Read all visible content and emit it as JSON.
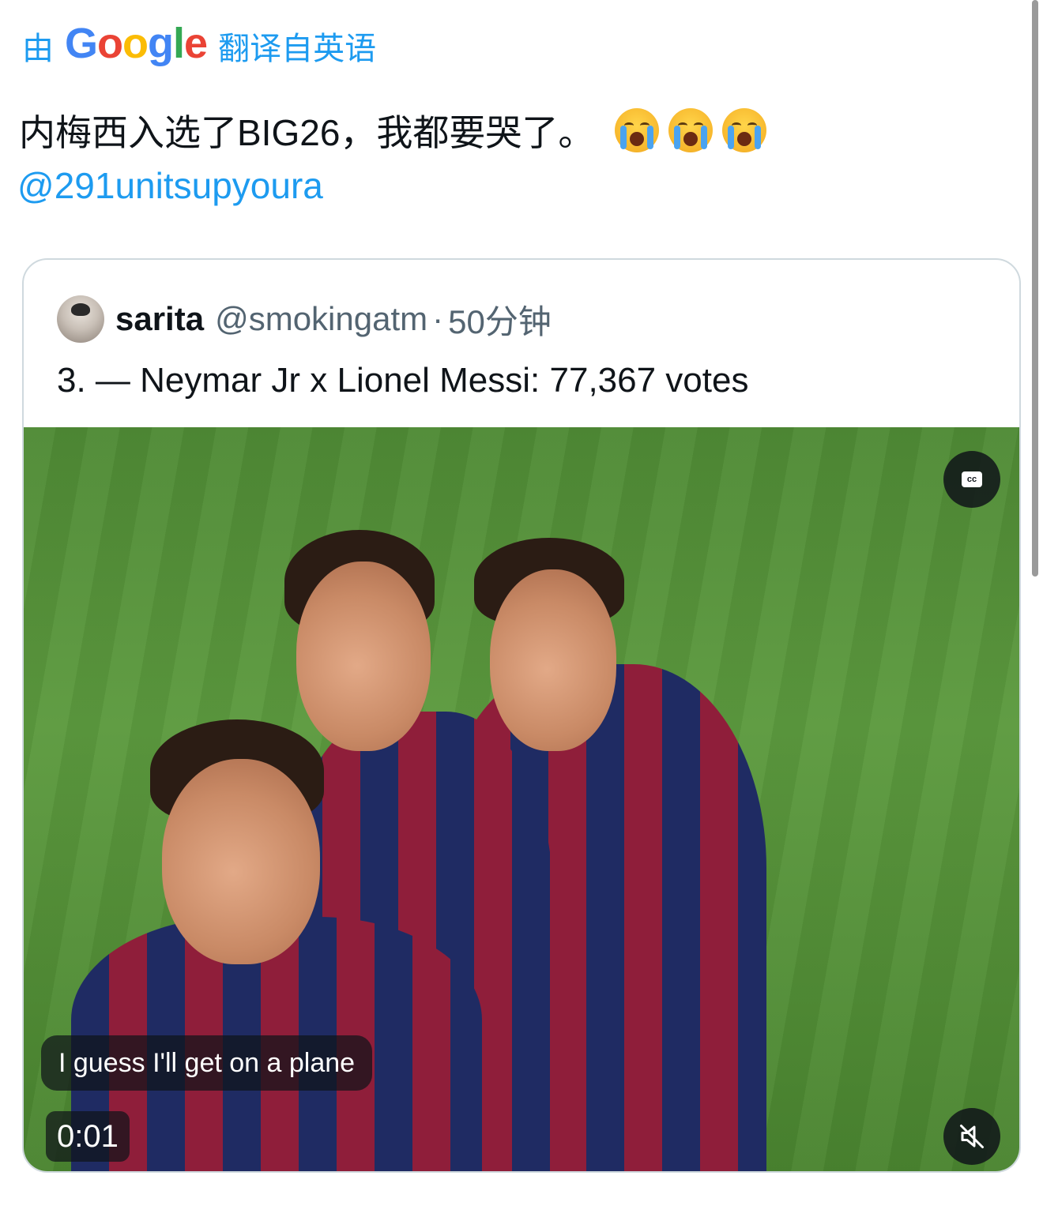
{
  "translation": {
    "prefix": "由",
    "logo_letters": [
      "G",
      "o",
      "o",
      "g",
      "l",
      "e"
    ],
    "suffix": "翻译自英语"
  },
  "tweet": {
    "text": "内梅西入选了BIG26，我都要哭了。",
    "emoji_name": "loudly-crying-face",
    "mention": "@291unitsupyoura"
  },
  "quote": {
    "name": "sarita",
    "handle": "@smokingatm",
    "separator": "·",
    "time": "50分钟",
    "text": "3. — Neymar Jr x Lionel Messi: 77,367 votes",
    "video": {
      "caption": "I guess I'll get on a plane",
      "timestamp": "0:01",
      "cc_label": "cc",
      "cc_icon": "closed-captions-icon",
      "mute_icon": "muted-speaker-icon"
    }
  },
  "colors": {
    "link": "#1d9bf0",
    "text": "#0f1419",
    "secondary": "#536471",
    "border": "#cfd9de"
  }
}
